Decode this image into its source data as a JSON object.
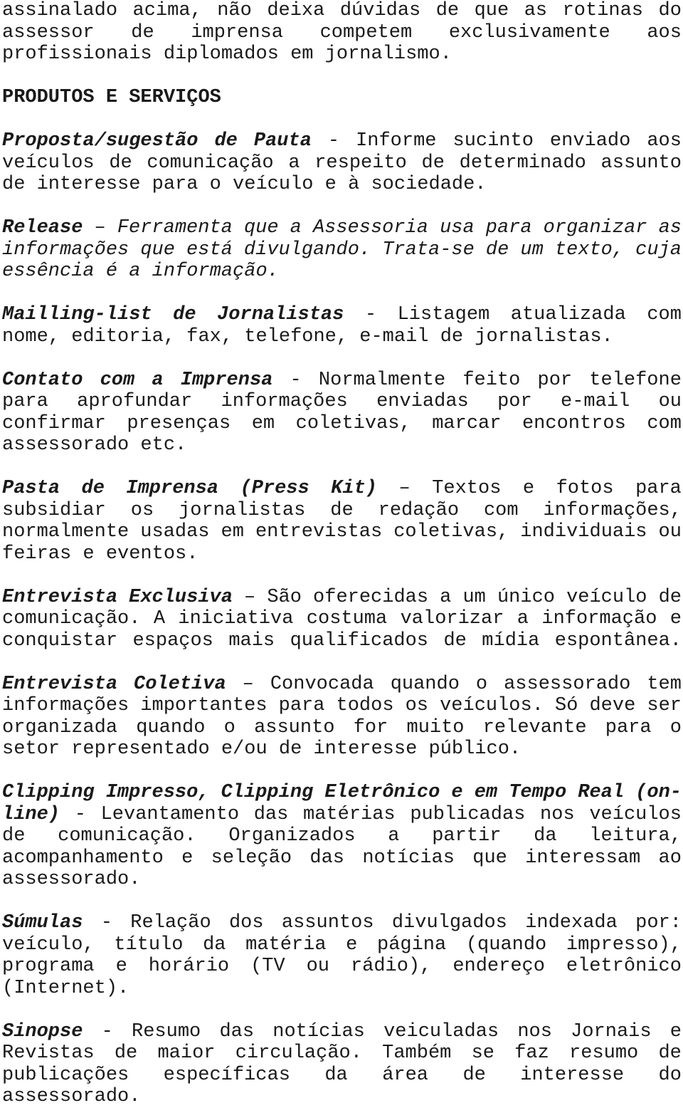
{
  "document": {
    "page_type": "scanned-text-page",
    "language": "pt-BR",
    "background_color": "#ffffff",
    "text_color": "#1a1a1a",
    "intro_paragraph": {
      "lines": [
        "assinalado acima, não deixa dúvidas de que as rotinas do",
        "assessor de imprensa competem exclusivamente aos",
        "profissionais diplomados em jornalismo."
      ],
      "full_text": "assinalado acima, não deixa dúvidas de que as rotinas do assessor de imprensa competem exclusivamente aos profissionais diplomados em jornalismo."
    },
    "section_heading": "PRODUTOS E SERVIÇOS",
    "entries": [
      {
        "term": "Proposta/sugestão de Pauta",
        "term_style": "bold-italic",
        "separator": "-",
        "body_style": "roman",
        "definition": "Informe sucinto enviado aos veículos de comunicação a respeito de determinado assunto de interesse para o veículo e à sociedade.",
        "lines": [
          {
            "term": "Proposta/sugestão de Pauta",
            "sep": "-",
            "rest": "Informe sucinto enviado aos"
          },
          {
            "rest": "veículos de comunicação a respeito de determinado assunto"
          },
          {
            "rest": "de interesse para o veículo e à sociedade."
          }
        ]
      },
      {
        "term": "Release",
        "term_style": "bold-italic",
        "separator": "–",
        "body_style": "italic",
        "definition": "Ferramenta que a Assessoria usa para organizar as informações que está divulgando. Trata-se de um texto, cuja essência é a informação.",
        "lines": [
          {
            "term": "Release",
            "sep": "–",
            "rest": "Ferramenta que a Assessoria usa para organizar as"
          },
          {
            "rest": "informações que está divulgando. Trata-se de um texto, cuja"
          },
          {
            "rest": "essência é a informação."
          }
        ]
      },
      {
        "term": "Mailling-list de Jornalistas",
        "term_style": "bold-italic",
        "separator": "-",
        "body_style": "roman",
        "definition": "Listagem atualizada com nome, editoria, fax, telefone, e-mail de jornalistas.",
        "lines": [
          {
            "term": "Mailling-list de Jornalistas",
            "sep": "-",
            "rest": "Listagem atualizada com"
          },
          {
            "rest": "nome, editoria, fax, telefone, e-mail de jornalistas."
          }
        ]
      },
      {
        "term": "Contato com a Imprensa",
        "term_style": "bold-italic",
        "separator": "-",
        "body_style": "roman",
        "definition": "Normalmente feito por telefone para aprofundar informações enviadas por e-mail ou confirmar presenças em coletivas, marcar encontros com assessorado etc.",
        "lines": [
          {
            "term": "Contato com a Imprensa",
            "sep": "-",
            "rest": "Normalmente feito por telefone"
          },
          {
            "rest": "para aprofundar informações enviadas por e-mail ou"
          },
          {
            "rest": "confirmar presenças em coletivas, marcar encontros com"
          },
          {
            "rest": "assessorado etc."
          }
        ]
      },
      {
        "term": "Pasta de Imprensa (Press Kit)",
        "term_style": "bold-italic",
        "separator": "–",
        "body_style": "roman",
        "definition": "Textos e fotos para subsidiar os jornalistas de redação com informações, normalmente usadas em entrevistas coletivas, individuais ou feiras e eventos.",
        "lines": [
          {
            "term": "Pasta de Imprensa (Press Kit)",
            "sep": "–",
            "rest": "Textos e fotos para"
          },
          {
            "rest": "subsidiar os jornalistas de redação com informações,"
          },
          {
            "rest": "normalmente usadas em entrevistas coletivas, individuais ou"
          },
          {
            "rest": "feiras e eventos."
          }
        ]
      },
      {
        "term": "Entrevista Exclusiva",
        "term_style": "bold-italic",
        "separator": "–",
        "body_style": "roman",
        "definition": "São oferecidas a um único veículo de comunicação. A iniciativa costuma valorizar a informação e conquistar espaços mais qualificados de mídia espontânea.",
        "lines": [
          {
            "term": "Entrevista Exclusiva",
            "sep": "–",
            "rest": "São oferecidas a um único veículo de"
          },
          {
            "rest": "comunicação. A iniciativa costuma valorizar a informação e"
          },
          {
            "rest": "conquistar espaços mais qualificados de mídia espontânea."
          }
        ]
      },
      {
        "term": "Entrevista Coletiva",
        "term_style": "bold-italic",
        "separator": "–",
        "body_style": "roman",
        "definition": "Convocada quando o assessorado tem informações importantes para todos os veículos. Só deve ser organizada quando o assunto for muito relevante para o setor representado e/ou de interesse público.",
        "lines": [
          {
            "term": "Entrevista Coletiva",
            "sep": "–",
            "rest": "Convocada quando o assessorado tem"
          },
          {
            "rest": "informações importantes para todos os veículos. Só deve ser"
          },
          {
            "rest": "organizada quando o assunto for muito relevante para o"
          },
          {
            "rest": "setor representado e/ou de interesse público."
          }
        ]
      },
      {
        "term": "Clipping Impresso, Clipping Eletrônico e em Tempo Real (on-line)",
        "term_style": "bold-italic",
        "separator": "-",
        "body_style": "roman",
        "definition": "Levantamento das matérias publicadas nos veículos de comunicação. Organizados a partir da leitura, acompanhamento e seleção das notícias que interessam ao assessorado.",
        "lines": [
          {
            "term_only": "Clipping Impresso, Clipping Eletrônico e em Tempo Real (on-"
          },
          {
            "term_head": "line)",
            "sep": "-",
            "rest": "Levantamento das matérias publicadas nos veículos"
          },
          {
            "rest": "de comunicação. Organizados a partir da leitura,"
          },
          {
            "rest": "acompanhamento e seleção das notícias que interessam ao"
          },
          {
            "rest": "assessorado."
          }
        ]
      },
      {
        "term": "Súmulas",
        "term_style": "bold-italic",
        "separator": "-",
        "body_style": "roman",
        "definition": "Relação dos assuntos divulgados indexada por: veículo, título da matéria e página (quando impresso), programa e horário (TV ou rádio), endereço eletrônico (Internet).",
        "lines": [
          {
            "term": "Súmulas",
            "sep": "-",
            "rest": "Relação dos assuntos divulgados indexada por:"
          },
          {
            "rest": "veículo, título da matéria e página (quando impresso),"
          },
          {
            "rest": "programa e horário (TV ou rádio), endereço eletrônico"
          },
          {
            "rest": "(Internet)."
          }
        ]
      },
      {
        "term": "Sinopse",
        "term_style": "bold-italic",
        "separator": "-",
        "body_style": "roman",
        "definition": "Resumo das notícias veiculadas nos Jornais e Revistas de maior circulação. Também se faz resumo de publicações específicas da área de interesse do assessorado.",
        "lines": [
          {
            "term": "Sinopse",
            "sep": "-",
            "rest": "Resumo das notícias veiculadas nos Jornais e"
          },
          {
            "rest": "Revistas de maior circulação. Também se faz resumo de"
          },
          {
            "rest": "publicações específicas da área de interesse do"
          },
          {
            "rest": "assessorado."
          }
        ]
      }
    ]
  }
}
